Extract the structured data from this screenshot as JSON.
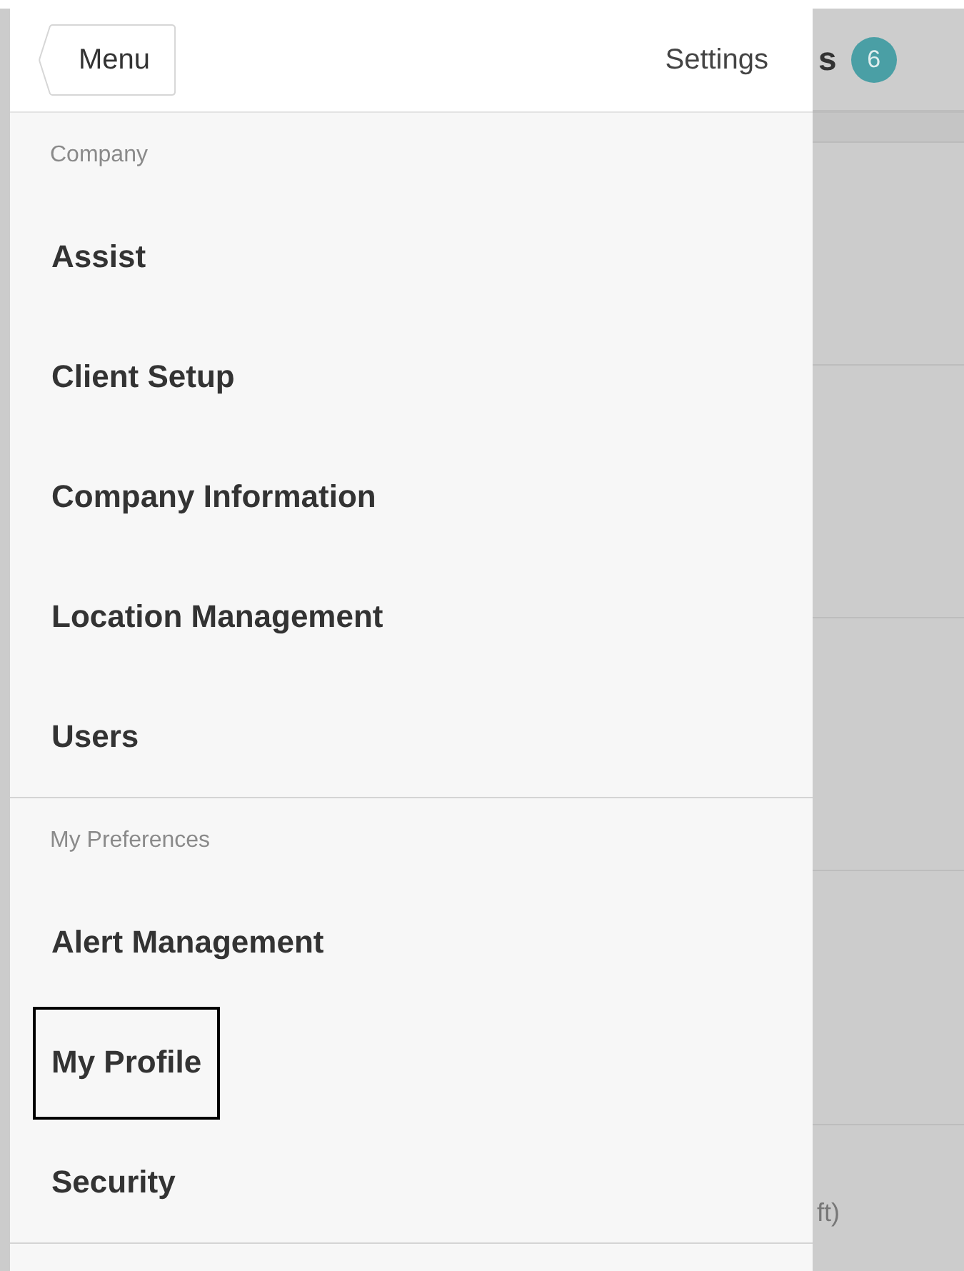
{
  "background": {
    "title_fragment": "s",
    "badge": "6",
    "row_fragment": "ft)"
  },
  "menu": {
    "back_button": "Menu",
    "title": "Settings",
    "sections": [
      {
        "heading": "Company",
        "items": [
          {
            "label": "Assist",
            "selected": false
          },
          {
            "label": "Client Setup",
            "selected": false
          },
          {
            "label": "Company Information",
            "selected": false
          },
          {
            "label": "Location Management",
            "selected": false
          },
          {
            "label": "Users",
            "selected": false
          }
        ]
      },
      {
        "heading": "My Preferences",
        "items": [
          {
            "label": "Alert Management",
            "selected": false
          },
          {
            "label": "My Profile",
            "selected": true
          },
          {
            "label": "Security",
            "selected": false
          }
        ]
      }
    ]
  }
}
